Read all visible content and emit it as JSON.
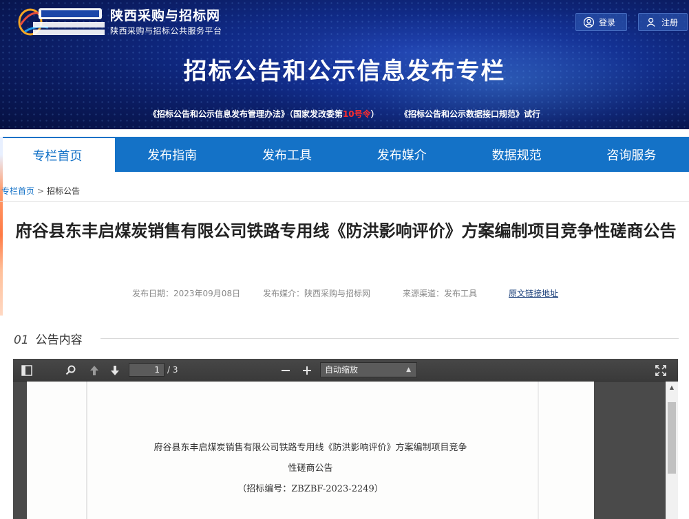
{
  "header": {
    "site_name": "陕西采购与招标网",
    "site_sub": "陕西采购与招标公共服务平台",
    "login": "登录",
    "register": "注册",
    "banner_title": "招标公告和公示信息发布专栏",
    "note_part1": "《招标公告和公示信息发布管理办法》（国家发改委第",
    "note_red": "10号令",
    "note_part2": "）",
    "note_part3": "《招标公告和公示数据接口规范》试行"
  },
  "nav": {
    "items": [
      "专栏首页",
      "发布指南",
      "发布工具",
      "发布媒介",
      "数据规范",
      "咨询服务"
    ],
    "active": 0
  },
  "breadcrumb": {
    "home": "专栏首页",
    "sep": ">",
    "current": "招标公告"
  },
  "article": {
    "title": "府谷县东丰启煤炭销售有限公司铁路专用线《防洪影响评价》方案编制项目竞争性磋商公告",
    "date": "发布日期：2023年09月08日",
    "media": "发布媒介：陕西采购与招标网",
    "source": "来源渠道：发布工具",
    "original_link": "原文链接地址"
  },
  "section": {
    "num": "01",
    "title": "公告内容"
  },
  "viewer": {
    "page_current": "1",
    "page_total": "/ 3",
    "zoom": "自动缩放",
    "doc_line1": "府谷县东丰启煤炭销售有限公司铁路专用线《防洪影响评价》方案编制项目竞争",
    "doc_line2": "性磋商公告",
    "doc_line3": "（招标编号：ZBZBF-2023-2249）"
  },
  "colors": {
    "nav_blue": "#1472c7",
    "banner_blue": "#102a86",
    "note_red": "#ff2d2d"
  }
}
